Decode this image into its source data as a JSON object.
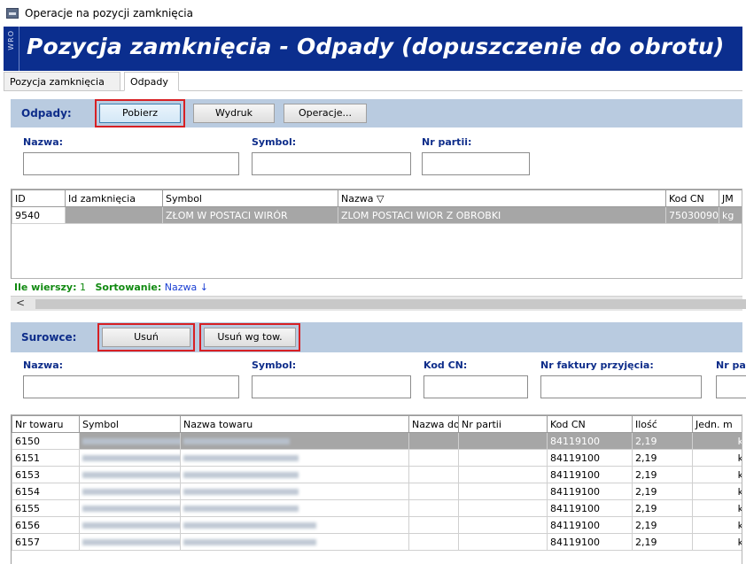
{
  "window": {
    "title": "Operacje na pozycji zamknięcia"
  },
  "banner": {
    "side_text": "WRO",
    "title": "Pozycja zamknięcia - Odpady (dopuszczenie do obrotu)"
  },
  "tabs": [
    {
      "label": "Pozycja zamknięcia"
    },
    {
      "label": "Odpady"
    }
  ],
  "odpady": {
    "label": "Odpady:",
    "buttons": {
      "pobierz": "Pobierz",
      "wydruk": "Wydruk",
      "operacje": "Operacje..."
    },
    "filters": {
      "nazwa": "Nazwa:",
      "symbol": "Symbol:",
      "nr_partii": "Nr partii:"
    },
    "columns": [
      "ID",
      "Id zamknięcia",
      "Symbol",
      "Nazwa ▽",
      "Kod CN",
      "JM"
    ],
    "rows": [
      {
        "id": "9540",
        "id_zamkniecia": "",
        "symbol": "ZŁOM W POSTACI WIRÓR",
        "nazwa": "ZLOM POSTACI WIOR Z OBROBKI",
        "kod_cn": "75030090",
        "jm": "kg"
      }
    ],
    "status": {
      "rows_label": "Ile wierszy:",
      "rows_value": "1",
      "sort_label": "Sortowanie:",
      "sort_value": "Nazwa ↓"
    },
    "scroll_left": "<"
  },
  "surowce": {
    "label": "Surowce:",
    "buttons": {
      "usun": "Usuń",
      "usun_wg_tow": "Usuń wg tow."
    },
    "filters": {
      "nazwa": "Nazwa:",
      "symbol": "Symbol:",
      "kod_cn": "Kod CN:",
      "nr_faktury": "Nr faktury przyjęcia:",
      "nr_pa": "Nr pa"
    },
    "columns": [
      "Nr towaru",
      "Symbol",
      "Nazwa towaru",
      "Nazwa do",
      "Nr partii",
      "Kod CN",
      "Ilość",
      "Jedn. m"
    ],
    "rows": [
      {
        "nr": "6150",
        "kod_cn": "84119100",
        "ilosc": "2,19",
        "jm": "kg"
      },
      {
        "nr": "6151",
        "kod_cn": "84119100",
        "ilosc": "2,19",
        "jm": "kg"
      },
      {
        "nr": "6153",
        "kod_cn": "84119100",
        "ilosc": "2,19",
        "jm": "kg"
      },
      {
        "nr": "6154",
        "kod_cn": "84119100",
        "ilosc": "2,19",
        "jm": "kg"
      },
      {
        "nr": "6155",
        "kod_cn": "84119100",
        "ilosc": "2,19",
        "jm": "kg"
      },
      {
        "nr": "6156",
        "kod_cn": "84119100",
        "ilosc": "2,19",
        "jm": "kg"
      },
      {
        "nr": "6157",
        "kod_cn": "84119100",
        "ilosc": "2,19",
        "jm": "kg"
      }
    ]
  },
  "colors": {
    "banner": "#0b2e8e",
    "panel": "#b9cbe0",
    "highlight": "#d72024",
    "label": "#0e2d8a",
    "status_green": "#118a11"
  },
  "icons": [
    "app-window-icon",
    "sort-down-icon",
    "chevron-left-icon"
  ]
}
